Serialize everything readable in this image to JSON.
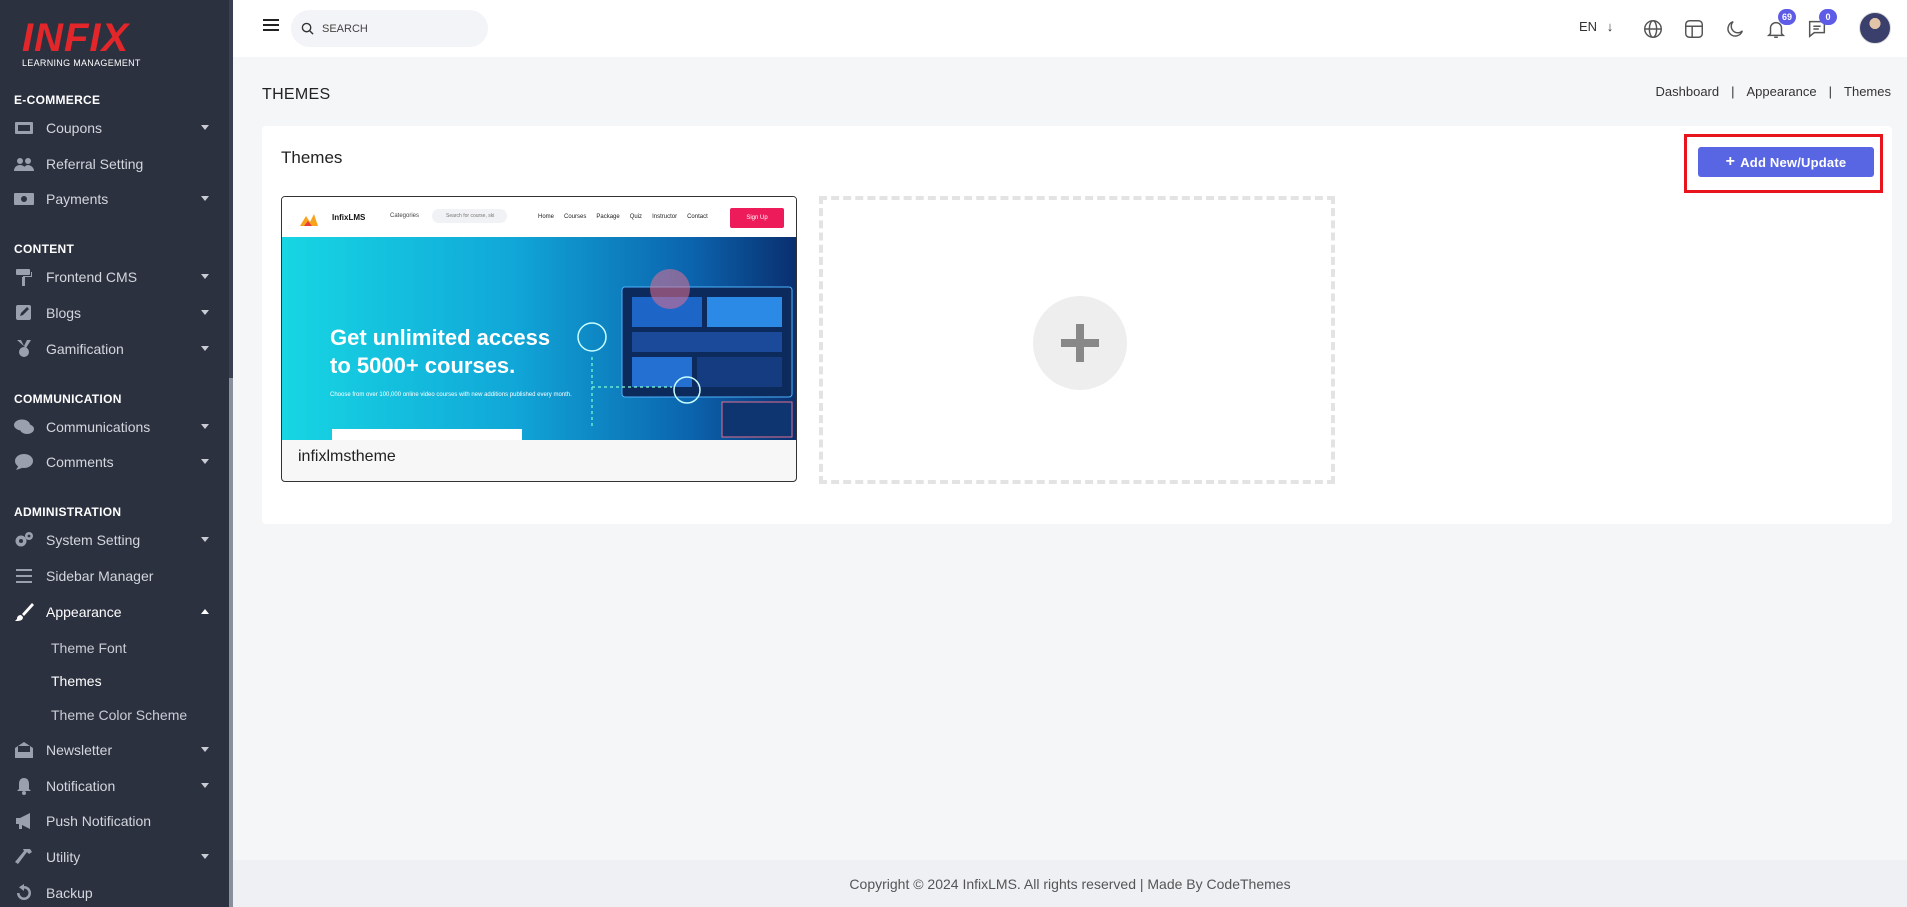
{
  "brand": {
    "logo_text": "INFIX",
    "logo_sub": "LEARNING MANAGEMENT"
  },
  "sidebar": {
    "sections": [
      {
        "title": "E-COMMERCE"
      },
      {
        "title": "CONTENT"
      },
      {
        "title": "COMMUNICATION"
      },
      {
        "title": "ADMINISTRATION"
      }
    ],
    "items": [
      {
        "label": "Coupons"
      },
      {
        "label": "Referral Setting"
      },
      {
        "label": "Payments"
      },
      {
        "label": "Frontend CMS"
      },
      {
        "label": "Blogs"
      },
      {
        "label": "Gamification"
      },
      {
        "label": "Communications"
      },
      {
        "label": "Comments"
      },
      {
        "label": "System Setting"
      },
      {
        "label": "Sidebar Manager"
      },
      {
        "label": "Appearance"
      },
      {
        "label": "Newsletter"
      },
      {
        "label": "Notification"
      },
      {
        "label": "Push Notification"
      },
      {
        "label": "Utility"
      },
      {
        "label": "Backup"
      }
    ],
    "appearance_sub": [
      {
        "label": "Theme Font"
      },
      {
        "label": "Themes"
      },
      {
        "label": "Theme Color Scheme"
      }
    ]
  },
  "topbar": {
    "search_placeholder": "SEARCH",
    "language": "EN",
    "notifications_count": "69",
    "messages_count": "0"
  },
  "page": {
    "title": "THEMES",
    "breadcrumb": [
      "Dashboard",
      "Appearance",
      "Themes"
    ],
    "card_title": "Themes",
    "add_button_label": "Add New/Update"
  },
  "themes": [
    {
      "name": "infixlmstheme",
      "preview": {
        "brand": "InfixLMS",
        "categories": "Categories",
        "search": "Search for course, ski",
        "nav": [
          "Home",
          "Courses",
          "Package",
          "Quiz",
          "Instructor",
          "Contact"
        ],
        "signup": "Sign Up",
        "headline_1": "Get unlimited access",
        "headline_2": "to 5000+ courses.",
        "subtext": "Choose from over 100,000 online video courses with new additions published every month."
      }
    }
  ],
  "footer": {
    "copyright": "Copyright © 2024 InfixLMS. All rights reserved | Made By CodeThemes"
  },
  "colors": {
    "sidebar_bg": "#2c3140",
    "accent": "#5966e3",
    "highlight_border": "#e8141c",
    "logo_red": "#e3262a"
  }
}
